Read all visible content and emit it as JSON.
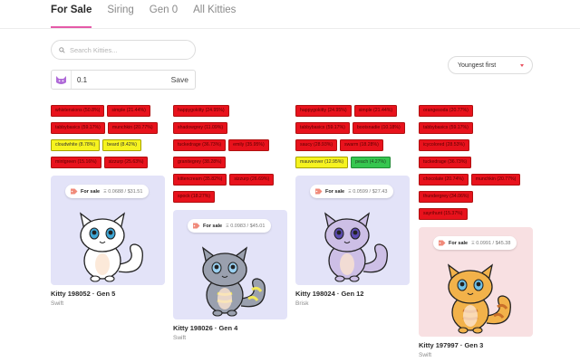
{
  "tabs": [
    {
      "label": "For Sale"
    },
    {
      "label": "Siring"
    },
    {
      "label": "Gen 0"
    },
    {
      "label": "All Kitties"
    }
  ],
  "search": {
    "placeholder": "Search Kitties..."
  },
  "price_filter": {
    "value": "0.1",
    "save_label": "Save"
  },
  "sort": {
    "selected": "Youngest first"
  },
  "colors": {
    "accent": "#e55aa8",
    "tag_red": "#e8121c",
    "tag_yellow": "#f6f31f",
    "tag_green": "#35c64f"
  },
  "columns": [
    {
      "tags": [
        {
          "label": "whixtensions (50.8%)",
          "color": "red"
        },
        {
          "label": "simple (21.44%)",
          "color": "red"
        },
        {
          "break": true
        },
        {
          "label": "tabbybasics (59.17%)",
          "color": "red"
        },
        {
          "label": "munchkin (20.77%)",
          "color": "red"
        },
        {
          "break": true
        },
        {
          "label": "cloudwhite (8.78%)",
          "color": "yellow"
        },
        {
          "label": "beard (8.42%)",
          "color": "yellow"
        },
        {
          "break": true
        },
        {
          "label": "mintgreen (15.16%)",
          "color": "red"
        },
        {
          "label": "sizzurp (25.63%)",
          "color": "red"
        }
      ],
      "card": {
        "price_icon": "price-tag-icon",
        "for_sale": "For sale",
        "price": "Ξ 0.0688 / $31.51",
        "title": "Kitty 198052 · Gen 5",
        "speed": "Swift",
        "bg": "#e3e3f8"
      }
    },
    {
      "tags": [
        {
          "label": "happygokitty (24.95%)",
          "color": "red"
        },
        {
          "break": true
        },
        {
          "label": "shadowgrey (11.09%)",
          "color": "red"
        },
        {
          "break": true
        },
        {
          "label": "tuckedrage (36.73%)",
          "color": "red"
        },
        {
          "label": "emily (35.95%)",
          "color": "red"
        },
        {
          "break": true
        },
        {
          "label": "granitegrey (38.28%)",
          "color": "red"
        },
        {
          "break": true
        },
        {
          "label": "kittencream (35.82%)",
          "color": "red"
        },
        {
          "label": "sizzurp (26.69%)",
          "color": "red"
        },
        {
          "break": true
        },
        {
          "label": "spock (18.27%)",
          "color": "red"
        }
      ],
      "card": {
        "price_icon": "price-tag-icon",
        "for_sale": "For sale",
        "price": "Ξ 0.0983 / $45.01",
        "title": "Kitty 198026 · Gen 4",
        "speed": "Swift",
        "bg": "#e3e3f8"
      }
    },
    {
      "tags": [
        {
          "label": "happygokitty (24.95%)",
          "color": "red"
        },
        {
          "label": "simple (21.44%)",
          "color": "red"
        },
        {
          "break": true
        },
        {
          "label": "tabbybasics (59.17%)",
          "color": "red"
        },
        {
          "label": "bootsnadie (10.18%)",
          "color": "red"
        },
        {
          "break": true
        },
        {
          "label": "saucy (28.93%)",
          "color": "red"
        },
        {
          "label": "swarm (18.28%)",
          "color": "red"
        },
        {
          "break": true
        },
        {
          "label": "mauveover (12.95%)",
          "color": "yellow"
        },
        {
          "label": "peach (4.27%)",
          "color": "green"
        }
      ],
      "card": {
        "price_icon": "price-tag-icon",
        "for_sale": "For sale",
        "price": "Ξ 0.0599 / $27.43",
        "title": "Kitty 198024 · Gen 12",
        "speed": "Brisk",
        "bg": "#e3e3f8"
      }
    },
    {
      "tags": [
        {
          "label": "orangesoda (20.77%)",
          "color": "red"
        },
        {
          "break": true
        },
        {
          "label": "tabbybasics (59.17%)",
          "color": "red"
        },
        {
          "break": true
        },
        {
          "label": "icycolored (28.53%)",
          "color": "red"
        },
        {
          "break": true
        },
        {
          "label": "tuckedrage (36.73%)",
          "color": "red"
        },
        {
          "break": true
        },
        {
          "label": "chocolate (20.74%)",
          "color": "red"
        },
        {
          "label": "munchkin (20.77%)",
          "color": "red"
        },
        {
          "break": true
        },
        {
          "label": "thundergrey (34.06%)",
          "color": "red"
        },
        {
          "break": true
        },
        {
          "label": "sayrihunt (15.37%)",
          "color": "red"
        }
      ],
      "card": {
        "price_icon": "price-tag-icon",
        "for_sale": "For sale",
        "price": "Ξ 0.0991 / $45.38",
        "title": "Kitty 197997 · Gen 3",
        "speed": "Swift",
        "bg": "#f8e0e2"
      }
    }
  ]
}
